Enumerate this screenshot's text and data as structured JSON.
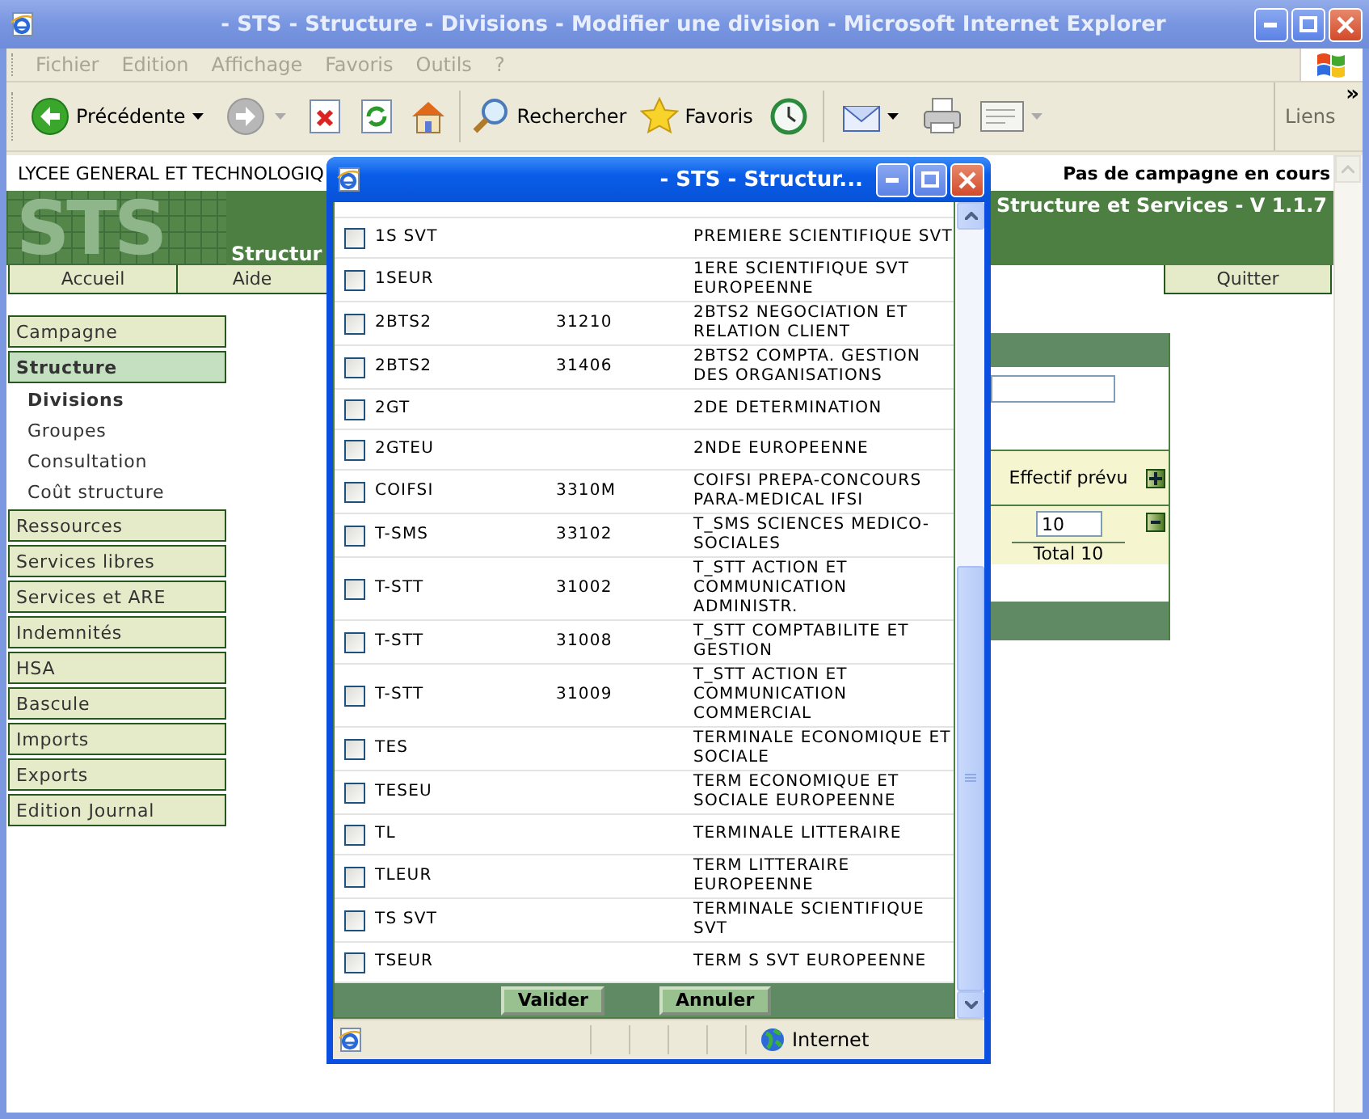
{
  "window": {
    "title": "- STS - Structure - Divisions - Modifier une division - Microsoft Internet Explorer"
  },
  "menu": [
    "Fichier",
    "Edition",
    "Affichage",
    "Favoris",
    "Outils",
    "?"
  ],
  "toolbar": {
    "back": "Précédente",
    "search": "Rechercher",
    "favorites": "Favoris",
    "links": "Liens",
    "more": "»"
  },
  "page": {
    "school": "LYCEE GENERAL ET TECHNOLOGIQ",
    "campaign": "Pas de campagne en cours",
    "logo": "STS",
    "banner_title": "Structur",
    "app_version": "Structure et Services - V 1.1.7",
    "nav": [
      "Accueil",
      "Aide"
    ],
    "quit": "Quitter",
    "sidebar": [
      {
        "label": "Campagne",
        "kind": "section",
        "selected": false
      },
      {
        "label": "Structure",
        "kind": "section",
        "selected": true
      },
      {
        "label": "Divisions",
        "kind": "sub",
        "selected": true
      },
      {
        "label": "Groupes",
        "kind": "sub",
        "selected": false
      },
      {
        "label": "Consultation",
        "kind": "sub",
        "selected": false
      },
      {
        "label": "Coût structure",
        "kind": "sub",
        "selected": false
      },
      {
        "label": "Ressources",
        "kind": "section",
        "selected": false
      },
      {
        "label": "Services libres",
        "kind": "section",
        "selected": false
      },
      {
        "label": "Services et ARE",
        "kind": "section",
        "selected": false
      },
      {
        "label": "Indemnités",
        "kind": "section",
        "selected": false
      },
      {
        "label": "HSA",
        "kind": "section",
        "selected": false
      },
      {
        "label": "Bascule",
        "kind": "section",
        "selected": false
      },
      {
        "label": "Imports",
        "kind": "section",
        "selected": false
      },
      {
        "label": "Exports",
        "kind": "section",
        "selected": false
      },
      {
        "label": "Edition Journal",
        "kind": "section",
        "selected": false
      }
    ],
    "panel": {
      "column_header": "Effectif prévu",
      "effectif": "10",
      "total": "Total 10"
    }
  },
  "popup": {
    "title": "- STS - Structur...",
    "rows": [
      {
        "code": "1S SVT",
        "number": "",
        "label": "PREMIERE SCIENTIFIQUE SVT",
        "checked": false
      },
      {
        "code": "1SEUR",
        "number": "",
        "label": "1ERE SCIENTIFIQUE SVT EUROPEENNE",
        "checked": false
      },
      {
        "code": "2BTS2",
        "number": "31210",
        "label": "2BTS2 NEGOCIATION ET RELATION CLIENT",
        "checked": false
      },
      {
        "code": "2BTS2",
        "number": "31406",
        "label": "2BTS2 COMPTA. GESTION DES ORGANISATIONS",
        "checked": false
      },
      {
        "code": "2GT",
        "number": "",
        "label": "2DE DETERMINATION",
        "checked": false
      },
      {
        "code": "2GTEU",
        "number": "",
        "label": "2NDE EUROPEENNE",
        "checked": false
      },
      {
        "code": "COIFSI",
        "number": "3310M",
        "label": "COIFSI PREPA-CONCOURS PARA-MEDICAL IFSI",
        "checked": false
      },
      {
        "code": "T-SMS",
        "number": "33102",
        "label": "T_SMS SCIENCES MEDICO-SOCIALES",
        "checked": false
      },
      {
        "code": "T-STT",
        "number": "31002",
        "label": "T_STT ACTION ET COMMUNICATION ADMINISTR.",
        "checked": false
      },
      {
        "code": "T-STT",
        "number": "31008",
        "label": "T_STT COMPTABILITE ET GESTION",
        "checked": false
      },
      {
        "code": "T-STT",
        "number": "31009",
        "label": "T_STT ACTION ET COMMUNICATION COMMERCIAL",
        "checked": false
      },
      {
        "code": "TES",
        "number": "",
        "label": "TERMINALE ECONOMIQUE ET SOCIALE",
        "checked": false
      },
      {
        "code": "TESEU",
        "number": "",
        "label": "TERM ECONOMIQUE ET SOCIALE EUROPEENNE",
        "checked": false
      },
      {
        "code": "TL",
        "number": "",
        "label": "TERMINALE LITTERAIRE",
        "checked": false
      },
      {
        "code": "TLEUR",
        "number": "",
        "label": "TERM LITTERAIRE EUROPEENNE",
        "checked": false
      },
      {
        "code": "TS SVT",
        "number": "",
        "label": "TERMINALE SCIENTIFIQUE SVT",
        "checked": false
      },
      {
        "code": "TSEUR",
        "number": "",
        "label": "TERM S SVT EUROPEENNE",
        "checked": false
      }
    ],
    "buttons": [
      "Valider",
      "Annuler"
    ],
    "status": "Internet"
  }
}
